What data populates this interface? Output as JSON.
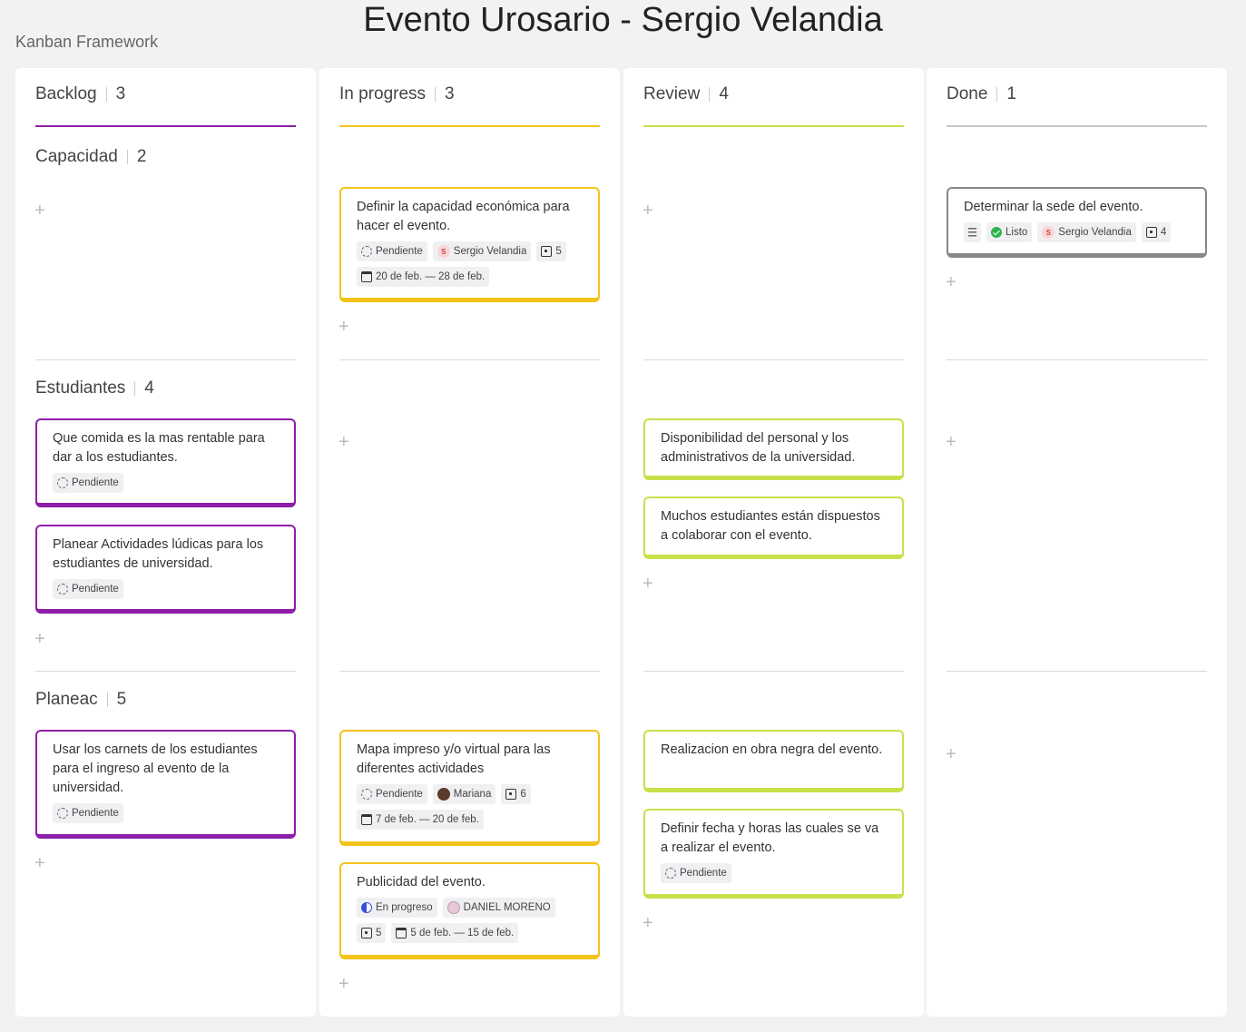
{
  "header": {
    "title": "Evento Urosario - Sergio Velandia",
    "subtitle": "Kanban Framework"
  },
  "columns": [
    {
      "name": "Backlog",
      "count": "3",
      "color": "#8e1ea8"
    },
    {
      "name": "In progress",
      "count": "3",
      "color": "#f2c31b"
    },
    {
      "name": "Review",
      "count": "4",
      "color": "#c9e04a"
    },
    {
      "name": "Done",
      "count": "1",
      "color": "#c8c8c8"
    }
  ],
  "groups": [
    {
      "name": "Capacidad",
      "count": "2"
    },
    {
      "name": "Estudiantes",
      "count": "4"
    },
    {
      "name": "Planeac",
      "count": "5"
    }
  ],
  "add_label": "+",
  "cards": {
    "c1": {
      "text": "Definir la capacidad económica para hacer el evento.",
      "status": "Pendiente",
      "assignee": "Sergio Velandia",
      "estimate": "5",
      "dates": "20 de feb. — 28 de feb."
    },
    "c2": {
      "text": "Determinar la sede del evento.",
      "status": "Listo",
      "assignee": "Sergio Velandia",
      "estimate": "4"
    },
    "c3": {
      "text": "Que comida es la mas rentable para dar a los estudiantes.",
      "status": "Pendiente"
    },
    "c4": {
      "text": "Planear Actividades lúdicas para los estudiantes de universidad.",
      "status": "Pendiente"
    },
    "c5": {
      "text": "Disponibilidad del personal y los administrativos de la universidad."
    },
    "c6": {
      "text": "Muchos estudiantes están dispuestos a colaborar con el evento."
    },
    "c7": {
      "text": "Usar los carnets de los estudiantes para el ingreso al evento de la universidad.",
      "status": "Pendiente"
    },
    "c8": {
      "text": "Mapa impreso y/o virtual para las diferentes actividades",
      "status": "Pendiente",
      "assignee": "Mariana",
      "estimate": "6",
      "dates": "7 de feb. — 20 de feb."
    },
    "c9": {
      "text": "Publicidad del evento.",
      "status": "En progreso",
      "assignee": "DANIEL MORENO",
      "estimate": "5",
      "dates": "5 de feb. — 15 de feb."
    },
    "c10": {
      "text": "Realizacion en obra negra del evento."
    },
    "c11": {
      "text": "Definir fecha y horas las cuales se va a realizar el evento.",
      "status": "Pendiente"
    }
  }
}
